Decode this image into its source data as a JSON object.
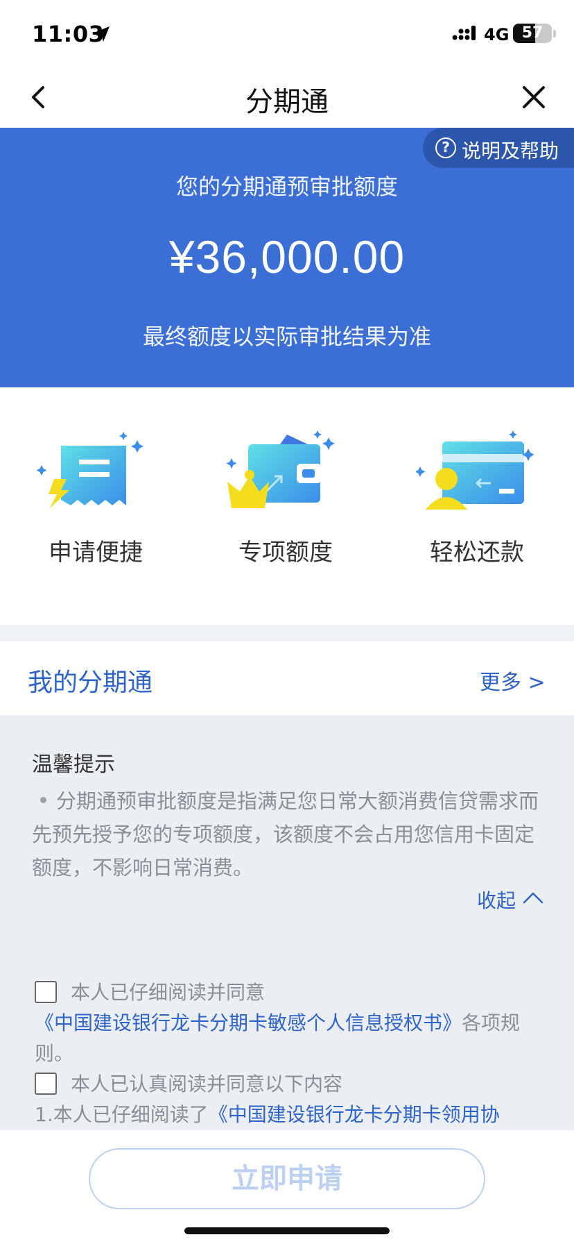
{
  "status_bar": {
    "time": "11:03",
    "network": "4G",
    "battery": "57",
    "battery_level": 0.57
  },
  "nav": {
    "title": "分期通",
    "back_icon": "chevron-left-icon",
    "close_icon": "close-icon"
  },
  "quota": {
    "help_label": "说明及帮助",
    "title": "您的分期通预审批额度",
    "amount": "¥36,000.00",
    "note": "最终额度以实际审批结果为准",
    "bg_color": "#3b6fd6"
  },
  "features": [
    {
      "label": "申请便捷",
      "icon": "receipt-lightning-icon"
    },
    {
      "label": "专项额度",
      "icon": "wallet-crown-icon"
    },
    {
      "label": "轻松还款",
      "icon": "card-user-icon"
    }
  ],
  "my_section": {
    "title": "我的分期通",
    "more": "更多 >"
  },
  "tips": {
    "title": "温馨提示",
    "body": "分期通预审批额度是指满足您日常大额消费信贷需求而先预先授予您的专项额度，该额度不会占用您信用卡固定额度，不影响日常消费。",
    "collapse": "收起"
  },
  "agreements": [
    {
      "lead": "本人已仔细阅读并同意",
      "link": "《中国建设银行龙卡分期卡敏感个人信息授权书》",
      "tail": "各项规则。"
    },
    {
      "lead": "本人已认真阅读并同意以下内容",
      "line2_prefix": "1.本人已仔细阅读了",
      "line2_link": "《中国建设银行龙卡分期卡领用协"
    }
  ],
  "apply_button": "立即申请"
}
